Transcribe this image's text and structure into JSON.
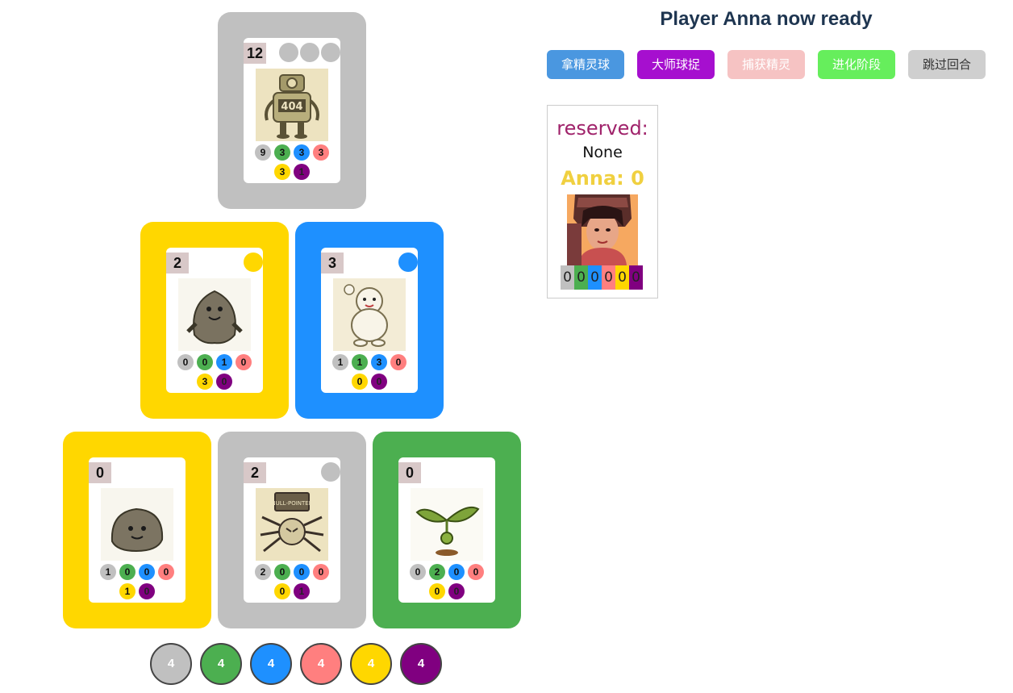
{
  "title": "Player Anna now ready",
  "buttons": [
    {
      "label": "拿精灵球",
      "color": "#4a97e0",
      "text_color": "#ffffff"
    },
    {
      "label": "大师球捉",
      "color": "#a60fcf",
      "text_color": "#ffffff"
    },
    {
      "label": "捕获精灵",
      "color": "#f6c3c3",
      "text_color": "#ffffff"
    },
    {
      "label": "进化阶段",
      "color": "#66ee5c",
      "text_color": "#ffffff"
    },
    {
      "label": "跳过回合",
      "color": "#cfcfcf",
      "text_color": "#333333"
    }
  ],
  "colors": {
    "gray": "#c0c0c0",
    "green": "#4caf50",
    "blue": "#1e90ff",
    "pink": "#ff7f7f",
    "yellow": "#ffd700",
    "purple": "#800080"
  },
  "cards": [
    {
      "score": "12",
      "slot_color": "#c0c0c0",
      "badges": [
        "#c0c0c0",
        "#c0c0c0",
        "#c0c0c0"
      ],
      "icon": "robot-404-icon",
      "costs": [
        "9",
        "3",
        "3",
        "3",
        "3",
        "1"
      ]
    },
    {
      "score": "2",
      "slot_color": "#ffd700",
      "badges": [
        "#ffd700"
      ],
      "icon": "rock-monster-icon",
      "costs": [
        "0",
        "0",
        "1",
        "0",
        "3",
        "0"
      ]
    },
    {
      "score": "3",
      "slot_color": "#1e90ff",
      "badges": [
        "#1e90ff"
      ],
      "icon": "cloud-creature-icon",
      "costs": [
        "1",
        "1",
        "3",
        "0",
        "0",
        "0"
      ]
    },
    {
      "score": "0",
      "slot_color": "#ffd700",
      "badges": [],
      "icon": "pebble-icon",
      "costs": [
        "1",
        "0",
        "0",
        "0",
        "1",
        "0"
      ]
    },
    {
      "score": "2",
      "slot_color": "#c0c0c0",
      "badges": [
        "#c0c0c0"
      ],
      "icon": "null-pointer-spider-icon",
      "sign_text": "NULL-POINTER",
      "costs": [
        "2",
        "0",
        "0",
        "0",
        "0",
        "1"
      ]
    },
    {
      "score": "0",
      "slot_color": "#4caf50",
      "badges": [],
      "icon": "sprout-icon",
      "costs": [
        "0",
        "2",
        "0",
        "0",
        "0",
        "0"
      ]
    }
  ],
  "art_404": "404",
  "panel": {
    "reserved_label": "reserved:",
    "reserved_value": "None",
    "player_score": "Anna: 0",
    "avatar_icon": "player-portrait-icon",
    "gems": [
      "0",
      "0",
      "0",
      "0",
      "0",
      "0"
    ]
  },
  "tokens": [
    "4",
    "4",
    "4",
    "4",
    "4",
    "4"
  ]
}
